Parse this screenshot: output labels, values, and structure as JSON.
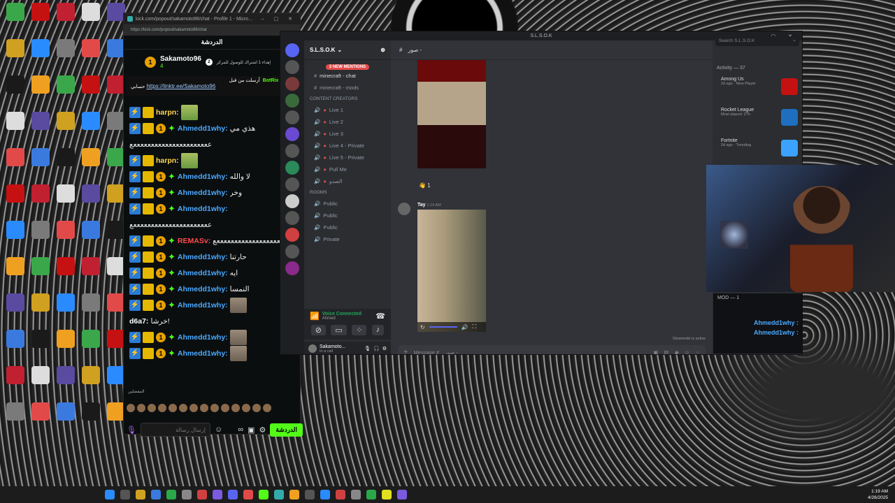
{
  "kick": {
    "titlebar": "kick.com/popout/sakamoto96/chat - Profile 1 - Micro...",
    "url": "https://kick.com/popout/sakamoto96/chat",
    "chat_tab": "الدردشة",
    "streamer": "Sakamoto96",
    "streamer_sub": "4",
    "gift_text": "2",
    "gift_msg": "إهداء 1 اشتراك للوصول للمركز",
    "pinned_by": "أرسلت من قبل",
    "pinned_user": "BotRix",
    "pinned_prefix": "حسابي",
    "pinned_link": "https://linktr.ee/Sakamoto96",
    "messages": [
      {
        "user": "harpn:",
        "color": "#ffd84d",
        "text": "",
        "badges": 2,
        "img": true
      },
      {
        "user": "Ahmedd1why:",
        "color": "#4aa9ff",
        "text": "هذي مي",
        "badges": 4
      },
      {
        "user": "",
        "color": "#ffffff",
        "text": "ععععععععععععععععععععععع",
        "badges": 0
      },
      {
        "user": "harpn:",
        "color": "#ffd84d",
        "text": "",
        "badges": 2,
        "img": true
      },
      {
        "user": "Ahmedd1why:",
        "color": "#4aa9ff",
        "text": "لا والله",
        "badges": 4
      },
      {
        "user": "Ahmedd1why:",
        "color": "#4aa9ff",
        "text": "وخر",
        "badges": 4
      },
      {
        "user": "Ahmedd1why:",
        "color": "#4aa9ff",
        "text": "",
        "badges": 4
      },
      {
        "user": "",
        "color": "#ffffff",
        "text": "ععععععععععععععععععععععع",
        "badges": 0
      },
      {
        "user": "REMASv:",
        "color": "#ff4b4b",
        "text": "ععععععععععععععععععععع",
        "badges": 3
      },
      {
        "user": "Ahmedd1why:",
        "color": "#4aa9ff",
        "text": "حارتنا",
        "badges": 4
      },
      {
        "user": "Ahmedd1why:",
        "color": "#4aa9ff",
        "text": "ايه",
        "badges": 4
      },
      {
        "user": "Ahmedd1why:",
        "color": "#4aa9ff",
        "text": "النمسا",
        "badges": 4
      },
      {
        "user": "Ahmedd1why:",
        "color": "#4aa9ff",
        "text": "",
        "badges": 4,
        "img": true
      },
      {
        "user": "d6a7:",
        "color": "#ffffff",
        "text": "خرشا!",
        "badges": 0
      },
      {
        "user": "Ahmedd1why:",
        "color": "#4aa9ff",
        "text": "",
        "badges": 4,
        "img": true
      },
      {
        "user": "Ahmedd1why:",
        "color": "#4aa9ff",
        "text": "",
        "badges": 4,
        "img": true
      }
    ],
    "emote_label": "المفضلين",
    "input_placeholder": "إرسال رسالة",
    "send_label": "الدردشة"
  },
  "discord": {
    "window_title": "S.L.S.O.K",
    "server_name": "S.L.S.O.K",
    "mentions_badge": "2 NEW MENTIONS",
    "channels_top": [
      "minecraft - chat",
      "minecraft - mods"
    ],
    "cat_creators": "CONTENT CREATORS",
    "live_channels": [
      "Live 1",
      "Live 2",
      "Live 3",
      "Live 4 - Private",
      "Live 5 - Private",
      "Pull Me",
      "الصدو"
    ],
    "cat_rooms": "ROOMS",
    "rooms": [
      "Public",
      "Public",
      "Public",
      "Private"
    ],
    "voice_status": "Voice Connected",
    "voice_user": "Ahmed",
    "user_name": "Sakamoto...",
    "user_status": "In a call",
    "channel_title": "صور -",
    "msg_author": "Tay",
    "msg_time": "1:19 AM",
    "reaction_count": "1",
    "input_placeholder": "Message #",
    "slowmode": "Slowmode is active",
    "search_placeholder": "Search S.L.S.O.K",
    "activity_label": "Activity — 37",
    "activities": [
      {
        "game": "Among Us",
        "meta": "2d ago · New Player",
        "color": "#c51111"
      },
      {
        "game": "Rocket League",
        "meta": "Most played: 27h",
        "color": "#1e6fbf"
      },
      {
        "game": "Fortnite",
        "meta": "2d ago · Trending",
        "color": "#3ba3ff"
      }
    ]
  },
  "overlay": {
    "mod_label": "MOD — 1",
    "lines": [
      "Ahmedd1why :",
      "Ahmedd1why :"
    ]
  },
  "taskbar": {
    "time": "1:19 AM",
    "date": "4/26/2025"
  }
}
